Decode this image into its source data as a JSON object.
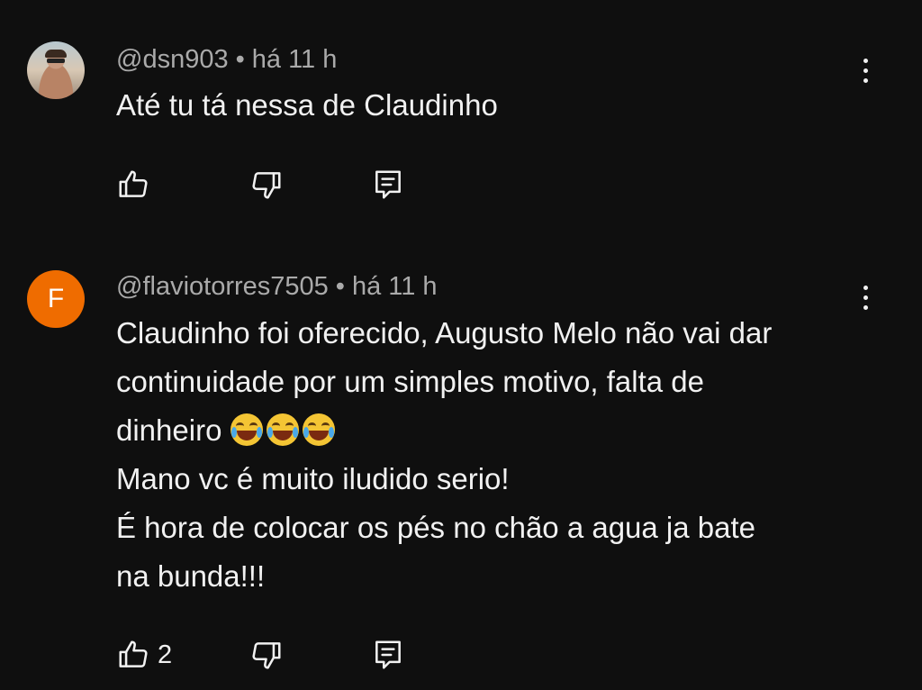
{
  "comments": [
    {
      "author": "@dsn903",
      "separator": "•",
      "time": "há 11 h",
      "avatar_kind": "photo",
      "text_lines": [
        "Até tu tá nessa de Claudinho"
      ],
      "like_count": ""
    },
    {
      "author": "@flaviotorres7505",
      "separator": "•",
      "time": "há 11 h",
      "avatar_kind": "letter",
      "avatar_letter": "F",
      "avatar_color": "#ef6c00",
      "text_lines": [
        "Claudinho foi oferecido, Augusto Melo não vai dar",
        "continuidade por um simples motivo, falta de",
        "dinheiro",
        "Mano vc é muito iludido serio!",
        "É hora de colocar os pés no chão a agua ja bate",
        "na bunda!!!"
      ],
      "emoji": "😂😂😂",
      "like_count": "2"
    }
  ],
  "icons": {
    "like": "like-icon",
    "dislike": "dislike-icon",
    "reply": "reply-icon",
    "more": "more-vert-icon"
  },
  "colors": {
    "background": "#0f0f0f",
    "text": "#f1f1f1",
    "meta": "#aaaaaa"
  }
}
